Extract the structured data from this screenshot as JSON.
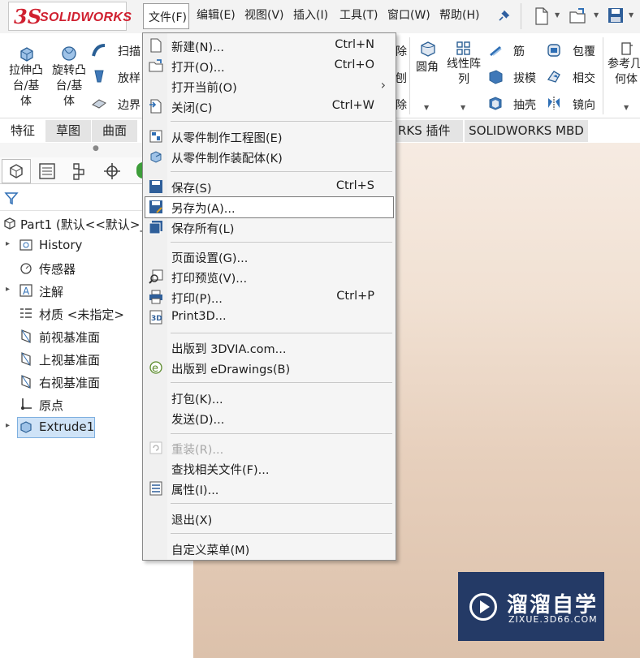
{
  "app": {
    "logo_ds": "3S",
    "logo_text": "SOLIDWORKS"
  },
  "menubar": {
    "items": [
      {
        "label": "文件(F)"
      },
      {
        "label": "编辑(E)"
      },
      {
        "label": "视图(V)"
      },
      {
        "label": "插入(I)"
      },
      {
        "label": "工具(T)"
      },
      {
        "label": "窗口(W)"
      },
      {
        "label": "帮助(H)"
      }
    ]
  },
  "ribbon": {
    "extrude_boss": [
      "拉伸凸",
      "台/基",
      "体"
    ],
    "revolve_boss": [
      "旋转凸",
      "台/基",
      "体"
    ],
    "sweep": "扫描",
    "loft": "放样",
    "boundary": "边界",
    "fillet": "圆角",
    "linear_pattern": [
      "线性阵",
      "列"
    ],
    "rib": "筋",
    "draft": "拔模",
    "shell": "抽壳",
    "wrap": "包覆",
    "intersect": "相交",
    "mirror": "镜向",
    "ref_geometry": [
      "参考几",
      "何体"
    ],
    "partial_right_1": "除",
    "partial_right_2": "刨",
    "partial_right_3": "除"
  },
  "tabs": [
    {
      "label": "特征"
    },
    {
      "label": "草图"
    },
    {
      "label": "曲面"
    },
    {
      "label": "RKS 插件"
    },
    {
      "label": "SOLIDWORKS MBD"
    }
  ],
  "tree": {
    "root": "Part1  (默认<<默认>_",
    "items": [
      {
        "label": "History",
        "expand": "▸"
      },
      {
        "label": "传感器",
        "expand": ""
      },
      {
        "label": "注解",
        "expand": "▸"
      },
      {
        "label": "材质 <未指定>",
        "expand": ""
      },
      {
        "label": "前视基准面",
        "expand": ""
      },
      {
        "label": "上视基准面",
        "expand": ""
      },
      {
        "label": "右视基准面",
        "expand": ""
      },
      {
        "label": "原点",
        "expand": ""
      },
      {
        "label": "Extrude1",
        "expand": "▸"
      }
    ]
  },
  "file_menu": {
    "items": [
      {
        "label": "新建(N)...",
        "shortcut": "Ctrl+N"
      },
      {
        "label": "打开(O)...",
        "shortcut": "Ctrl+O"
      },
      {
        "label": "打开当前(O)",
        "shortcut": "",
        "submenu": "›"
      },
      {
        "label": "关闭(C)",
        "shortcut": "Ctrl+W"
      },
      {
        "label": "从零件制作工程图(E)",
        "shortcut": ""
      },
      {
        "label": "从零件制作装配体(K)",
        "shortcut": ""
      },
      {
        "label": "保存(S)",
        "shortcut": "Ctrl+S"
      },
      {
        "label": "另存为(A)...",
        "shortcut": ""
      },
      {
        "label": "保存所有(L)",
        "shortcut": ""
      },
      {
        "label": "页面设置(G)...",
        "shortcut": ""
      },
      {
        "label": "打印预览(V)...",
        "shortcut": ""
      },
      {
        "label": "打印(P)...",
        "shortcut": "Ctrl+P"
      },
      {
        "label": "Print3D...",
        "shortcut": ""
      },
      {
        "label": "出版到 3DVIA.com...",
        "shortcut": ""
      },
      {
        "label": "出版到 eDrawings(B)",
        "shortcut": ""
      },
      {
        "label": "打包(K)...",
        "shortcut": ""
      },
      {
        "label": "发送(D)...",
        "shortcut": ""
      },
      {
        "label": "重装(R)...",
        "shortcut": "",
        "disabled": true
      },
      {
        "label": "查找相关文件(F)...",
        "shortcut": ""
      },
      {
        "label": "属性(I)...",
        "shortcut": ""
      },
      {
        "label": "退出(X)",
        "shortcut": ""
      },
      {
        "label": "自定义菜单(M)",
        "shortcut": ""
      }
    ]
  },
  "watermark": {
    "title": "溜溜自学",
    "subtitle": "ZIXUE.3D66.COM"
  },
  "colors": {
    "brand": "#d02030",
    "viewport_top": "#f6ebe2",
    "viewport_bottom": "#dcc1ab",
    "watermark_bg": "#243a66"
  }
}
